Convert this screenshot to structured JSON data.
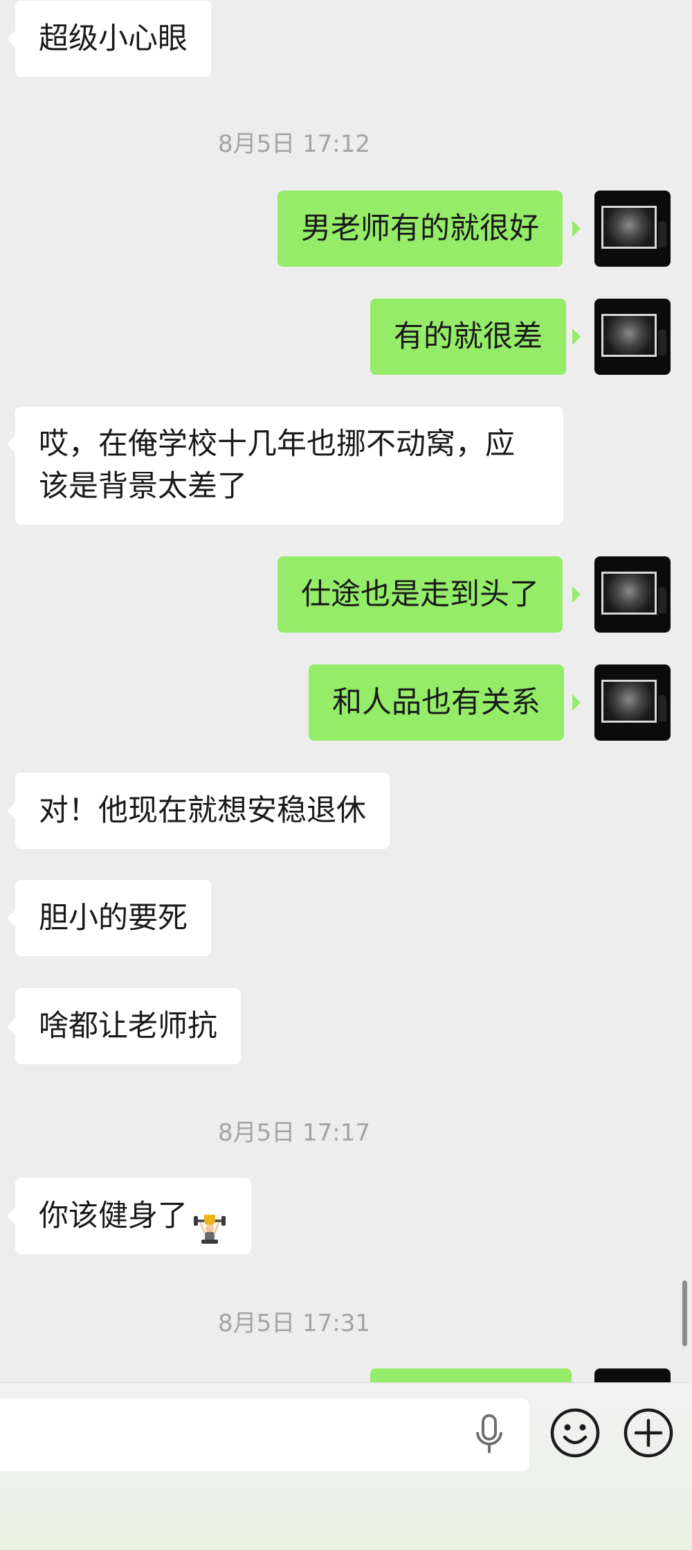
{
  "messages": [
    {
      "side": "recv",
      "text": "超级小心眼"
    },
    {
      "side": "time",
      "text": "8月5日 17:12"
    },
    {
      "side": "sent",
      "text": "男老师有的就很好"
    },
    {
      "side": "sent",
      "text": "有的就很差"
    },
    {
      "side": "recv",
      "text": "哎，在俺学校十几年也挪不动窝，应该是背景太差了"
    },
    {
      "side": "sent",
      "text": "仕途也是走到头了"
    },
    {
      "side": "sent",
      "text": "和人品也有关系"
    },
    {
      "side": "recv",
      "text": "对！他现在就想安稳退休"
    },
    {
      "side": "recv",
      "text": "胆小的要死"
    },
    {
      "side": "recv",
      "text": "啥都让老师抗"
    },
    {
      "side": "time",
      "text": "8月5日 17:17"
    },
    {
      "side": "recv",
      "text": "你该健身了",
      "emoji": "weightlifting-trophy-emoji"
    },
    {
      "side": "time",
      "text": "8月5日 17:31"
    }
  ],
  "colors": {
    "background": "#ededed",
    "sent_bubble": "#95ec69",
    "received_bubble": "#ffffff",
    "timestamp_text": "#a3a3a3"
  },
  "input_bar": {
    "icons": [
      "microphone-icon",
      "emoji-icon",
      "plus-icon"
    ]
  }
}
